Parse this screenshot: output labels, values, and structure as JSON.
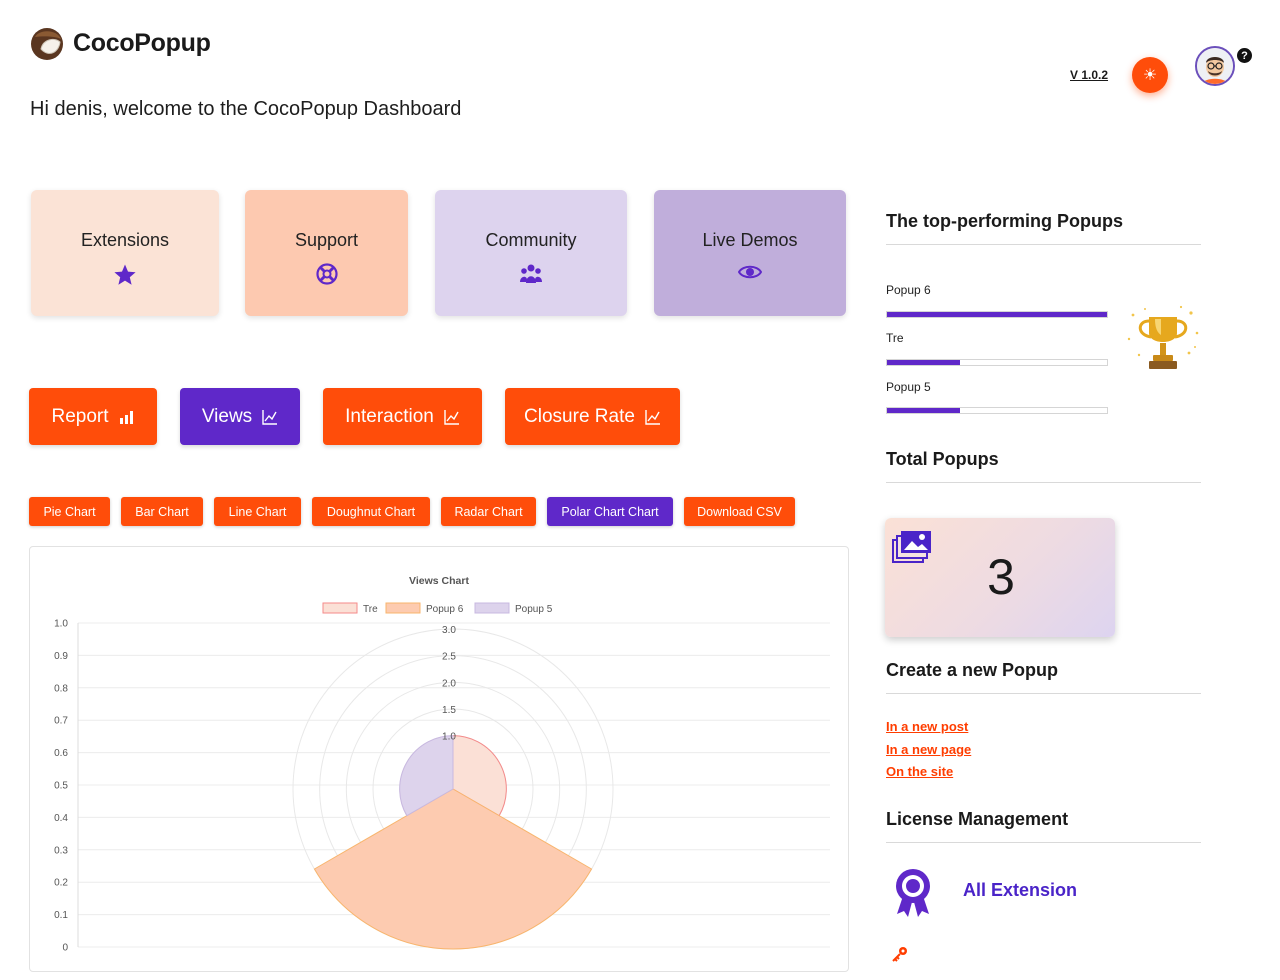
{
  "app": {
    "name": "CocoPopup",
    "welcome": "Hi denis, welcome to the CocoPopup Dashboard",
    "version": "V 1.0.2"
  },
  "colors": {
    "orange": "#ff4d0a",
    "purple": "#5f28c9",
    "card_peach_light": "#fbe3d6",
    "card_peach": "#fdc9b0",
    "card_lavender_light": "#ddd3ee",
    "card_lavender": "#c0aedb"
  },
  "cards": [
    {
      "label": "Extensions",
      "icon": "star-icon"
    },
    {
      "label": "Support",
      "icon": "lifebuoy-icon"
    },
    {
      "label": "Community",
      "icon": "users-icon"
    },
    {
      "label": "Live Demos",
      "icon": "eye-icon"
    }
  ],
  "metric_tabs": [
    {
      "label": "Report",
      "icon": "bar-chart-icon",
      "active": false
    },
    {
      "label": "Views",
      "icon": "line-chart-icon",
      "active": true
    },
    {
      "label": "Interaction",
      "icon": "line-chart-icon",
      "active": false
    },
    {
      "label": "Closure Rate",
      "icon": "line-chart-icon",
      "active": false
    }
  ],
  "chart_types": [
    {
      "label": "Pie Chart",
      "active": false
    },
    {
      "label": "Bar Chart",
      "active": false
    },
    {
      "label": "Line Chart",
      "active": false
    },
    {
      "label": "Doughnut Chart",
      "active": false
    },
    {
      "label": "Radar Chart",
      "active": false
    },
    {
      "label": "Polar Chart Chart",
      "active": true
    },
    {
      "label": "Download CSV",
      "active": false
    }
  ],
  "chart_data": {
    "type": "polar",
    "title": "Views Chart",
    "categories": [
      "Tre",
      "Popup 6",
      "Popup 5"
    ],
    "values": [
      1,
      3,
      1
    ],
    "colors": [
      "#fbe0d6",
      "#fdcbb0",
      "#ddd3ec"
    ],
    "border_colors": [
      "#f48a8a",
      "#f8b56d",
      "#c8b8e0"
    ],
    "r_ticks": [
      "1.0",
      "1.5",
      "2.0",
      "2.5",
      "3.0"
    ],
    "r_range": [
      0,
      3
    ],
    "y_ticks": [
      "1.0",
      "0.9",
      "0.8",
      "0.7",
      "0.6",
      "0.5",
      "0.4",
      "0.3",
      "0.2",
      "0.1",
      "0"
    ],
    "legend_position": "top"
  },
  "sidebar": {
    "top_title": "The top-performing Popups",
    "top_popups": [
      {
        "name": "Popup 6",
        "fraction": 1.0
      },
      {
        "name": "Tre",
        "fraction": 0.33
      },
      {
        "name": "Popup 5",
        "fraction": 0.33
      }
    ],
    "trophy_icon": "trophy-icon",
    "total_title": "Total Popups",
    "total_value": "3",
    "create_title": "Create a new Popup",
    "create_links": [
      "In a new post",
      "In a new page",
      "On the site"
    ],
    "license_title": "License Management",
    "license_name": "All Extension"
  }
}
